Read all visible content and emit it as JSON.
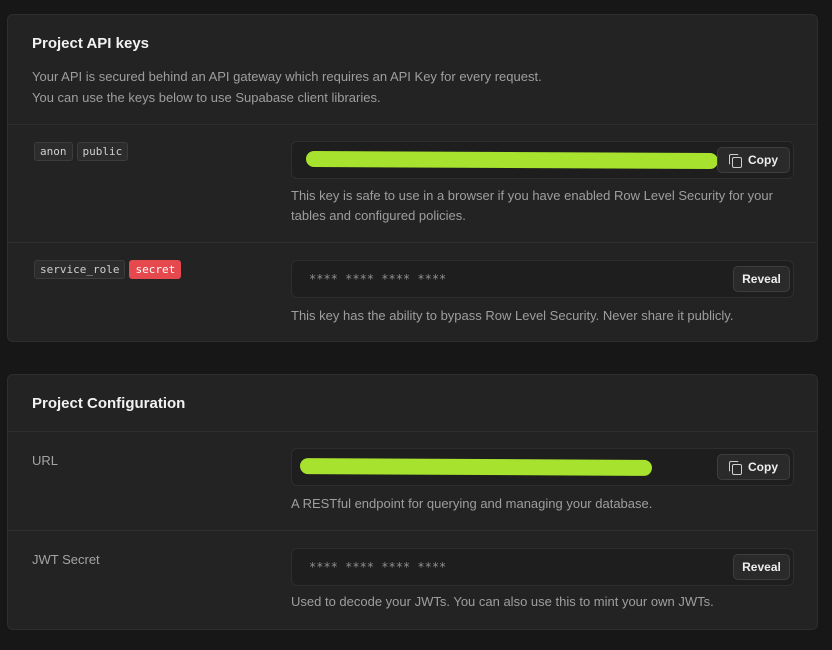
{
  "api_keys": {
    "title": "Project API keys",
    "description_line1": "Your API is secured behind an API gateway which requires an API Key for every request.",
    "description_line2": "You can use the keys below to use Supabase client libraries.",
    "anon": {
      "badges": [
        "anon",
        "public"
      ],
      "value": "",
      "copy_label": "Copy",
      "hint": "This key is safe to use in a browser if you have enabled Row Level Security for your tables and configured policies."
    },
    "service_role": {
      "badges": [
        "service_role",
        "secret"
      ],
      "masked_value": "**** **** **** ****",
      "reveal_label": "Reveal",
      "hint": "This key has the ability to bypass Row Level Security. Never share it publicly."
    }
  },
  "config": {
    "title": "Project Configuration",
    "url": {
      "label": "URL",
      "value": "",
      "copy_label": "Copy",
      "hint": "A RESTful endpoint for querying and managing your database."
    },
    "jwt": {
      "label": "JWT Secret",
      "masked_value": "**** **** **** ****",
      "reveal_label": "Reveal",
      "hint": "Used to decode your JWTs. You can also use this to mint your own JWTs."
    }
  },
  "colors": {
    "background": "#171717",
    "card": "#232323",
    "secret_badge": "#e5484d",
    "redaction_marker": "#a6e22e"
  },
  "icons": {
    "copy": "copy-icon"
  }
}
